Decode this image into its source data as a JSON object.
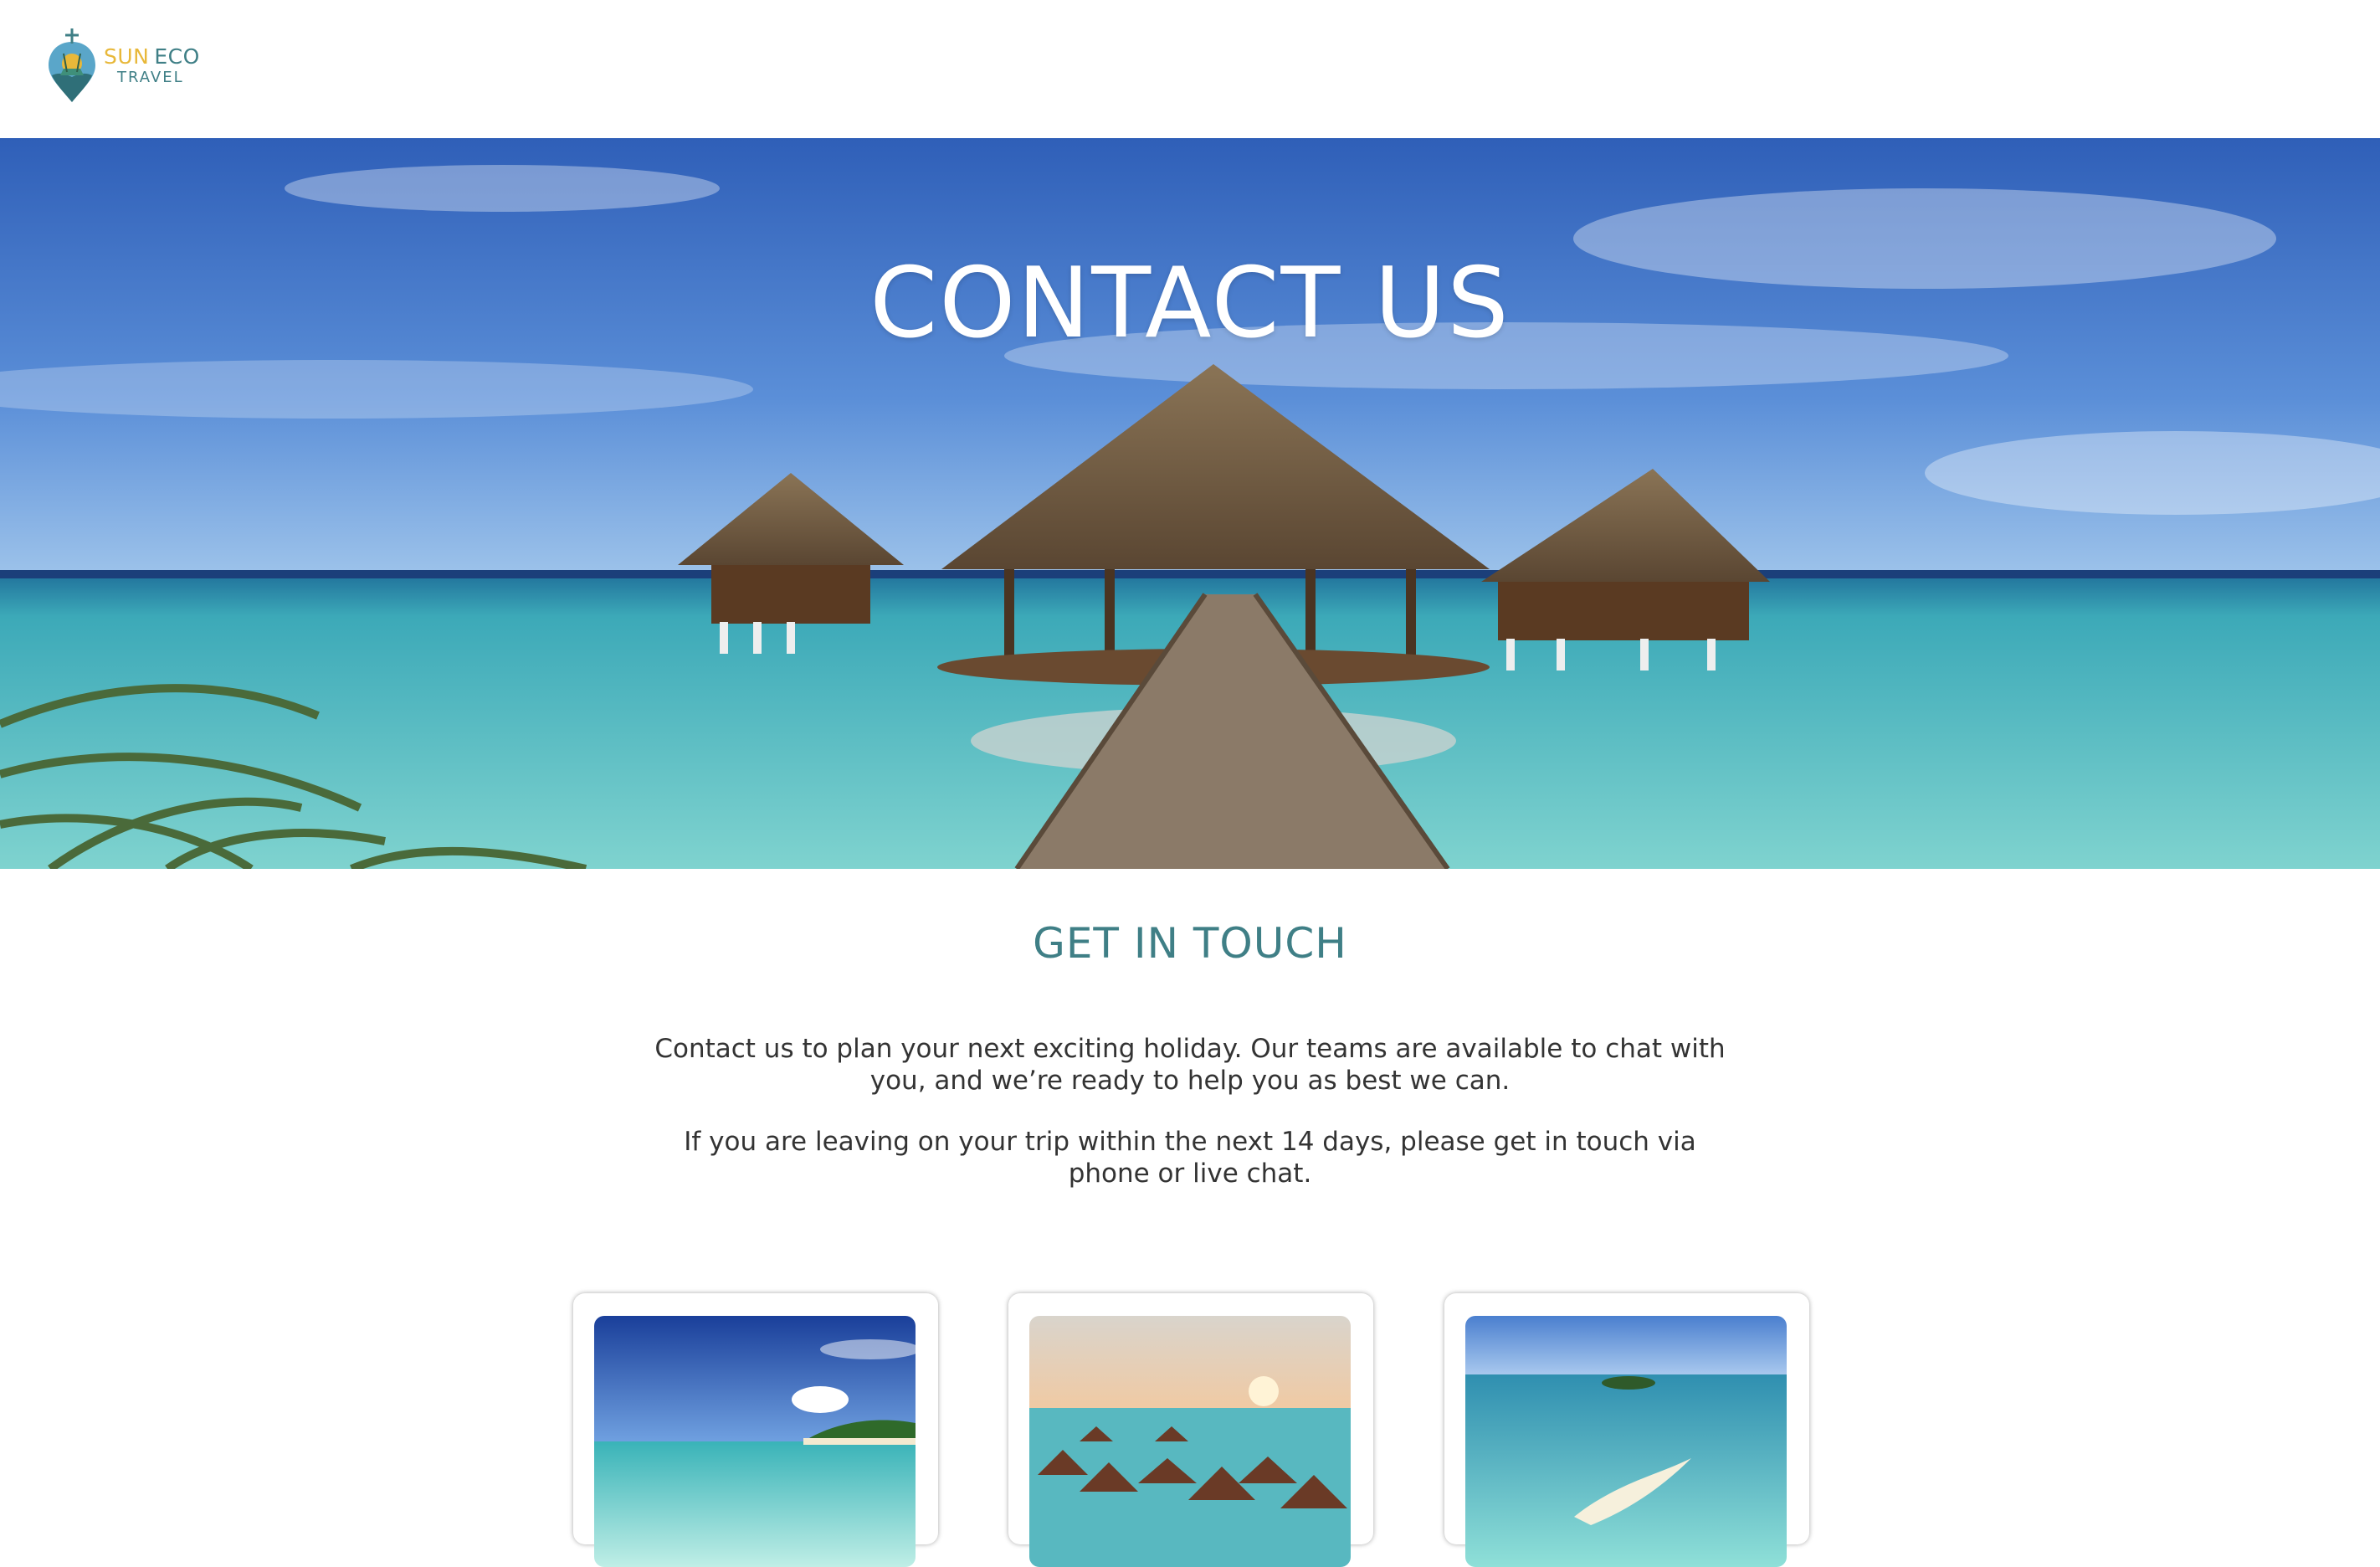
{
  "brand": {
    "name_part1": "SUN",
    "name_part2": "ECO",
    "name_line2": "TRAVEL"
  },
  "hero": {
    "title": "CONTACT US"
  },
  "contact": {
    "heading": "GET IN TOUCH",
    "paragraph1": "Contact us to plan your next exciting holiday. Our teams are available to chat with you, and we’re ready to help you as best we can.",
    "paragraph2": "If you are leaving on your trip within the next 14 days, please get in touch via phone or live chat."
  },
  "cards": [
    {
      "image": "tropical-beach-photo"
    },
    {
      "image": "water-villas-sunset-photo"
    },
    {
      "image": "island-sandbar-photo"
    }
  ],
  "colors": {
    "accent": "#3f7f86",
    "brand_yellow": "#e8b83a",
    "text": "#333333",
    "background": "#ffffff"
  }
}
